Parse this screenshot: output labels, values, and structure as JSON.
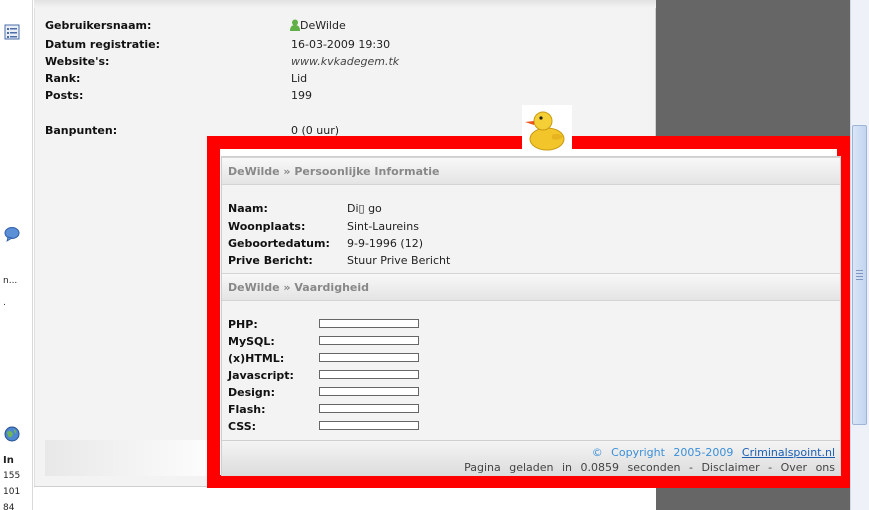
{
  "left_strip": {
    "labels": [
      "n...",
      ".",
      "In",
      "155",
      "101",
      "84"
    ]
  },
  "profile": {
    "rows": [
      {
        "label": "Gebruikersnaam:",
        "value": "DeWilde"
      },
      {
        "label": "Datum registratie:",
        "value": "16-03-2009 19:30"
      },
      {
        "label": "Website's:",
        "value": "www.kvkadegem.tk"
      },
      {
        "label": "Rank:",
        "value": "Lid"
      },
      {
        "label": "Posts:",
        "value": "199"
      },
      {
        "label": "Banpunten:",
        "value": "0 (0 uur)"
      }
    ]
  },
  "personal_info": {
    "title": "DeWilde » Persoonlijke Informatie",
    "rows": [
      {
        "label": "Naam:",
        "value": "Di▯ go"
      },
      {
        "label": "Woonplaats:",
        "value": "Sint-Laureins"
      },
      {
        "label": "Geboortedatum:",
        "value": "9-9-1996 (12)"
      },
      {
        "label": "Prive Bericht:",
        "value": "Stuur Prive Bericht"
      }
    ]
  },
  "skills": {
    "title": "DeWilde » Vaardigheid",
    "items": [
      {
        "label": "PHP:",
        "level": 0
      },
      {
        "label": "MySQL:",
        "level": 0
      },
      {
        "label": "(x)HTML:",
        "level": 0
      },
      {
        "label": "Javascript:",
        "level": 0
      },
      {
        "label": "Design:",
        "level": 0
      },
      {
        "label": "Flash:",
        "level": 0
      },
      {
        "label": "CSS:",
        "level": 0
      }
    ]
  },
  "footer": {
    "copyright_prefix": "© Copyright 2005-2009",
    "copyright_link": "Criminalspoint.nl",
    "load_text": "Pagina geladen in 0.0859 seconden",
    "sep": "-",
    "disclaimer": "Disclaimer",
    "about": "Over ons"
  },
  "colors": {
    "highlight": "#ff0000",
    "section_title": "#888888",
    "link": "#1a5fb4",
    "dark_area": "#666666"
  },
  "icons": [
    "list-icon",
    "speech-bubble-icon",
    "globe-icon",
    "user-icon",
    "duck-avatar"
  ]
}
